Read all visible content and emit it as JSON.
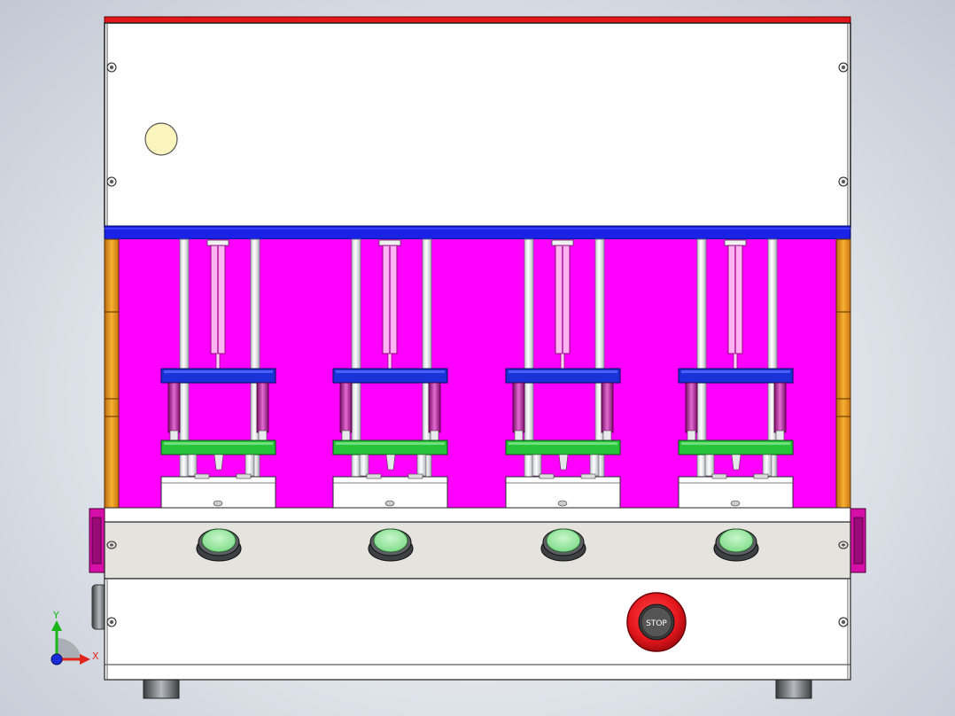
{
  "stop_button": {
    "label": "STOP",
    "color": "#e3161c"
  },
  "triad": {
    "x_label": "X",
    "y_label": "Y",
    "x_color": "#e0251c",
    "y_color": "#1bb41b",
    "z_color": "#1a2bd8"
  },
  "stations": [
    "station-1",
    "station-2",
    "station-3",
    "station-4"
  ],
  "colors": {
    "top_strip": "#e3161c",
    "cover": "#ffffff",
    "lamp": "#fbf5bd",
    "top_beam": "#1a22e6",
    "back_panel": "#ff00ff",
    "side_post": "#f6a41f",
    "press_plate": "#1a33d8",
    "base_plate": "#27c43a",
    "guide_sleeve": "#c01fa6",
    "front_panel": "#e4e3dd",
    "start_button": "#9ee6a3",
    "side_bracket": "#d60fa8"
  }
}
